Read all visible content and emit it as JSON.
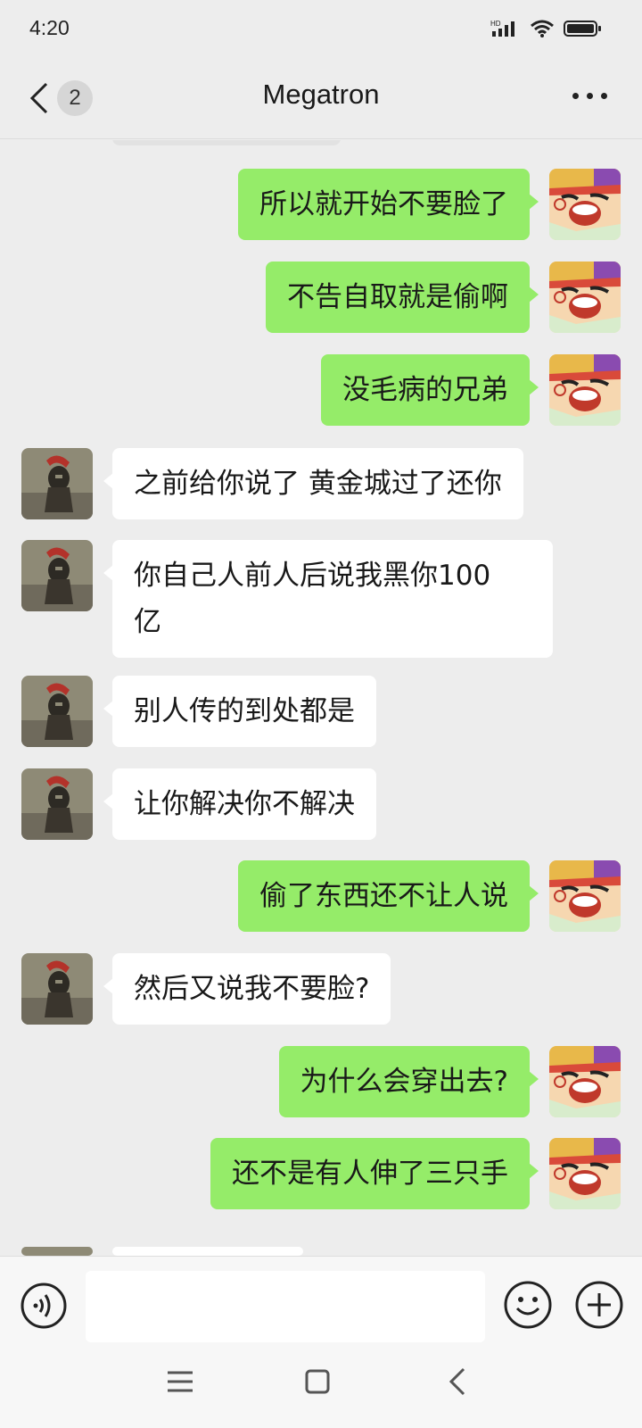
{
  "status_bar": {
    "time": "4:20",
    "network_label": "HD",
    "icons": [
      "signal-icon",
      "wifi-icon",
      "battery-icon"
    ]
  },
  "nav": {
    "back_icon": "chevron-left-icon",
    "unread_count": "2",
    "title": "Megatron",
    "more_icon": "more-dots-icon"
  },
  "colors": {
    "background": "#ededed",
    "my_bubble": "#95ec69",
    "other_bubble": "#ffffff",
    "text": "#191919"
  },
  "messages": [
    {
      "from": "me",
      "text": "所以就开始不要脸了"
    },
    {
      "from": "me",
      "text": "不告自取就是偷啊"
    },
    {
      "from": "me",
      "text": "没毛病的兄弟"
    },
    {
      "from": "other",
      "text": "之前给你说了 黄金城过了还你"
    },
    {
      "from": "other",
      "line1": "你自己人前人后说我黑你100",
      "line2": "亿"
    },
    {
      "from": "other",
      "text": "别人传的到处都是"
    },
    {
      "from": "other",
      "text": "让你解决你不解决"
    },
    {
      "from": "me",
      "text": "偷了东西还不让人说"
    },
    {
      "from": "other",
      "text": "然后又说我不要脸?"
    },
    {
      "from": "me",
      "text": "为什么会穿出去?"
    },
    {
      "from": "me",
      "text": "还不是有人伸了三只手"
    }
  ],
  "input_bar": {
    "voice_icon": "voice-icon",
    "text_value": "",
    "emoji_icon": "emoji-icon",
    "plus_icon": "plus-icon"
  },
  "system_nav": {
    "icons": [
      "menu-icon",
      "home-icon",
      "back-icon"
    ]
  }
}
